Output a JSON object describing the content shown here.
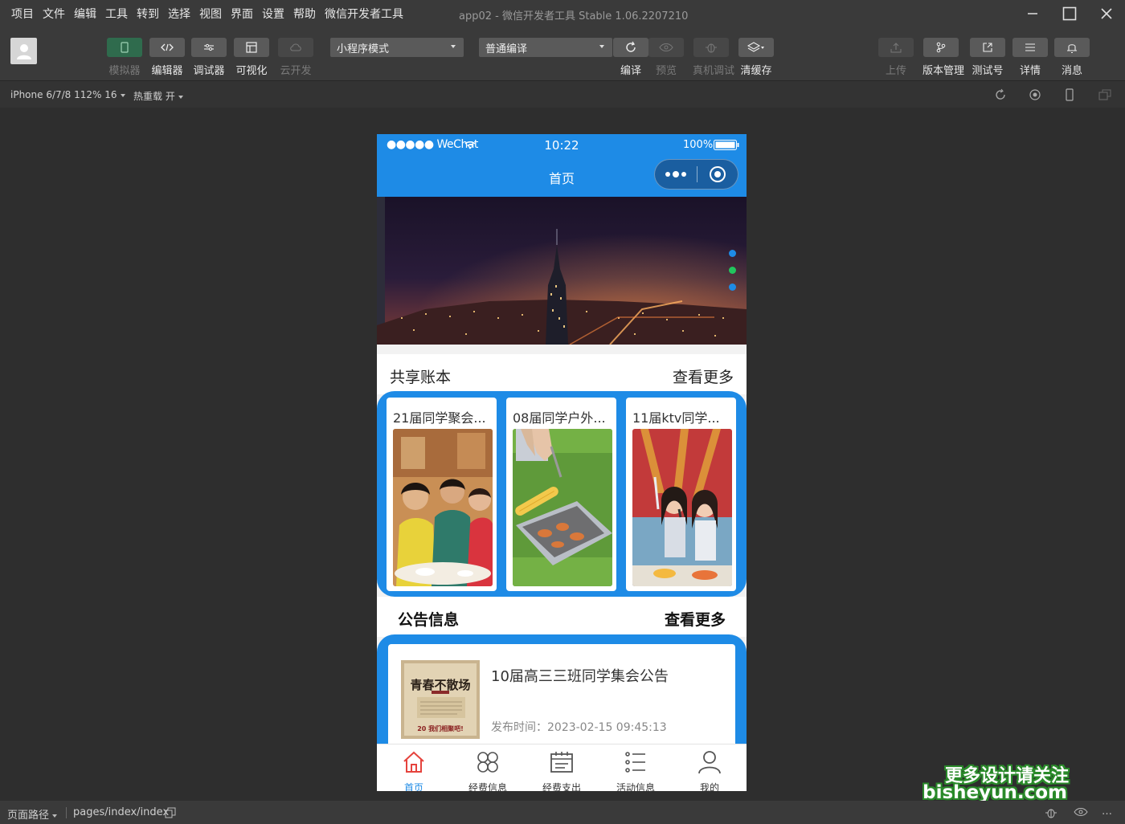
{
  "menu": [
    "项目",
    "文件",
    "编辑",
    "工具",
    "转到",
    "选择",
    "视图",
    "界面",
    "设置",
    "帮助",
    "微信开发者工具"
  ],
  "app_title": "app02 - 微信开发者工具 Stable 1.06.2207210",
  "toolbar": {
    "simulator": "模拟器",
    "editor": "编辑器",
    "debugger": "调试器",
    "visual": "可视化",
    "cloud": "云开发",
    "mode_select": "小程序模式",
    "compile_select": "普通编译",
    "compile": "编译",
    "preview": "预览",
    "remote_debug": "真机调试",
    "clear_cache": "清缓存",
    "upload": "上传",
    "version": "版本管理",
    "test_account": "测试号",
    "details": "详情",
    "messages": "消息"
  },
  "subbar": {
    "device": "iPhone 6/7/8 112% 16",
    "hot_reload": "热重载 开"
  },
  "phone": {
    "status_left": "●●●●● WeChat",
    "time": "10:22",
    "battery": "100%",
    "nav_title": "首页",
    "section1_left": "共享账本",
    "section1_right": "查看更多",
    "cards": [
      {
        "title": "21届同学聚会..."
      },
      {
        "title": "08届同学户外..."
      },
      {
        "title": "11届ktv同学..."
      }
    ],
    "section2_left": "公告信息",
    "section2_right": "查看更多",
    "notice": {
      "title": "10届高三三班同学集会公告",
      "time": "发布时间：2023-02-15 09:45:13",
      "poster_title": "青春不散场",
      "poster_sub": "20 我们相聚吧!"
    },
    "tabs": [
      "首页",
      "经费信息",
      "经费支出",
      "活动信息",
      "我的"
    ]
  },
  "bottom": {
    "path_label": "页面路径",
    "path": "pages/index/index"
  },
  "watermark": {
    "line1": "更多设计请关注",
    "line2": "bisheyun.com"
  },
  "colors": {
    "accent": "#1e8be6",
    "active_tab_icon": "#e5433d",
    "banner_dots": [
      "#1e8be6",
      "#22c55e",
      "#1e8be6"
    ]
  }
}
